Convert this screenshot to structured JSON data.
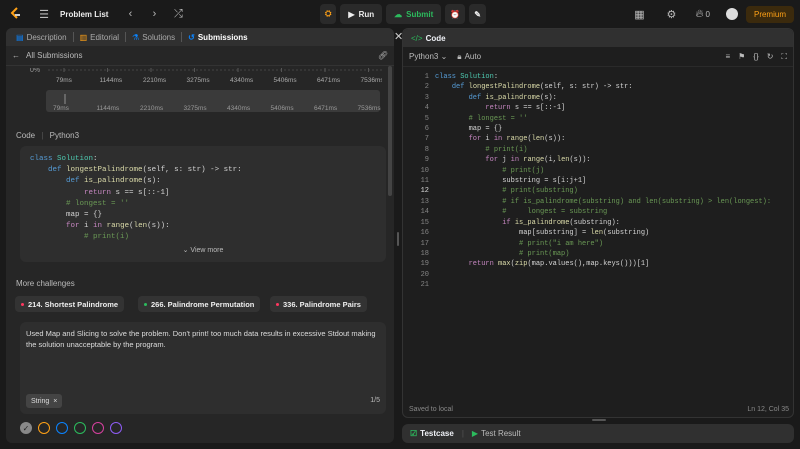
{
  "topbar": {
    "title": "Problem List",
    "run_label": "Run",
    "submit_label": "Submit",
    "coin_count": "0",
    "premium_label": "Premium"
  },
  "left_tabs": [
    {
      "label": "Description"
    },
    {
      "label": "Editorial"
    },
    {
      "label": "Solutions"
    },
    {
      "label": "Submissions"
    }
  ],
  "subhead": {
    "back_label": "All Submissions"
  },
  "chart_data": {
    "type": "bar",
    "ytick": "0%",
    "xticks": [
      "79ms",
      "1144ms",
      "2210ms",
      "3275ms",
      "4340ms",
      "5406ms",
      "6471ms",
      "7536ms"
    ],
    "mini_xticks": [
      "79ms",
      "1144ms",
      "2210ms",
      "3275ms",
      "4340ms",
      "5406ms",
      "6471ms",
      "7536ms"
    ]
  },
  "code_section": {
    "label": "Code",
    "language": "Python3",
    "view_more": "View more"
  },
  "more_challenges": {
    "label": "More challenges",
    "items": [
      {
        "label": "214. Shortest Palindrome",
        "color": "#ff375f"
      },
      {
        "label": "266. Palindrome Permutation",
        "color": "#2cbb5d"
      },
      {
        "label": "336. Palindrome Pairs",
        "color": "#ff375f"
      }
    ]
  },
  "note": {
    "text": "Used Map and Slicing to solve the problem. Don't print! too much data results in excessive Stdout making the solution unacceptable by the program.",
    "tag": "String",
    "page": "1/5"
  },
  "right": {
    "tab_label": "Code",
    "language": "Python3",
    "auto": "Auto",
    "saved": "Saved to local",
    "cursor": "Ln 12, Col 35"
  },
  "bottom": {
    "testcase": "Testcase",
    "result": "Test Result"
  },
  "colors": {
    "accent": "#ffa116",
    "green": "#2cbb5d",
    "blue": "#0a84ff"
  }
}
